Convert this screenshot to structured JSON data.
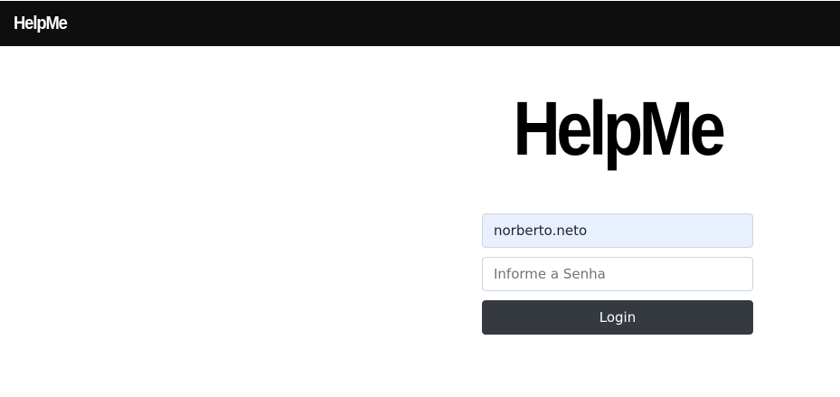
{
  "navbar": {
    "brand": "HelpMe"
  },
  "login": {
    "logo_text": "HelpMe",
    "username": {
      "value": "norberto.neto"
    },
    "password": {
      "placeholder": "Informe a Senha"
    },
    "login_label": "Login"
  },
  "colors": {
    "navbar_bg": "#0e0e0e",
    "autofill_bg": "#e8f0fe",
    "button_bg": "#343a40"
  }
}
